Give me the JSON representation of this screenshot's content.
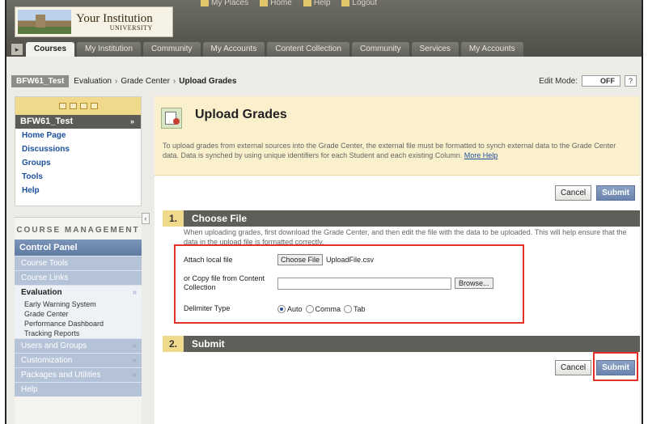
{
  "header": {
    "logo_line1": "Your Institution",
    "logo_line2": "UNIVERSITY",
    "top_links": [
      "My Places",
      "Home",
      "Help",
      "Logout"
    ]
  },
  "tabs": [
    "Courses",
    "My Institution",
    "Community",
    "My Accounts",
    "Content Collection",
    "Community",
    "Services",
    "My Accounts"
  ],
  "breadcrumb": {
    "course": "BFW61_Test",
    "items": [
      "Evaluation",
      "Grade Center",
      "Upload Grades"
    ],
    "edit_mode_label": "Edit Mode:",
    "edit_mode_value": "OFF",
    "help": "?"
  },
  "course_menu": {
    "title": "BFW61_Test",
    "items": [
      "Home Page",
      "Discussions",
      "Groups",
      "Tools",
      "Help"
    ]
  },
  "course_management": {
    "heading": "COURSE MANAGEMENT",
    "control_panel": "Control Panel",
    "rows_before": [
      "Course Tools",
      "Course Links"
    ],
    "evaluation": "Evaluation",
    "evaluation_items": [
      "Early Warning System",
      "Grade Center",
      "Performance Dashboard",
      "Tracking Reports"
    ],
    "rows_after": [
      "Users and Groups",
      "Customization",
      "Packages and Utilities",
      "Help"
    ]
  },
  "page": {
    "title": "Upload Grades",
    "description": "To upload grades from external sources into the Grade Center, the external file must be formatted to synch external data to the Grade Center data. Data is synched by using unique identifiers for each Student and each existing Column.",
    "more_help": "More Help",
    "cancel": "Cancel",
    "submit": "Submit"
  },
  "section1": {
    "num": "1.",
    "title": "Choose File",
    "instructions": "When uploading grades, first download the Grade Center, and then edit the file with the data to be uploaded. This will help ensure that the data in the upload file is formatted correctly.",
    "attach_label": "Attach local file",
    "choose_button": "Choose File",
    "file_name": "UploadFile.csv",
    "copy_label": "or Copy file from Content Collection",
    "copy_value": "",
    "browse_button": "Browse...",
    "delimiter_label": "Delimiter Type",
    "delimiter_options": [
      "Auto",
      "Comma",
      "Tab"
    ],
    "delimiter_selected": "Auto"
  },
  "section2": {
    "num": "2.",
    "title": "Submit"
  }
}
